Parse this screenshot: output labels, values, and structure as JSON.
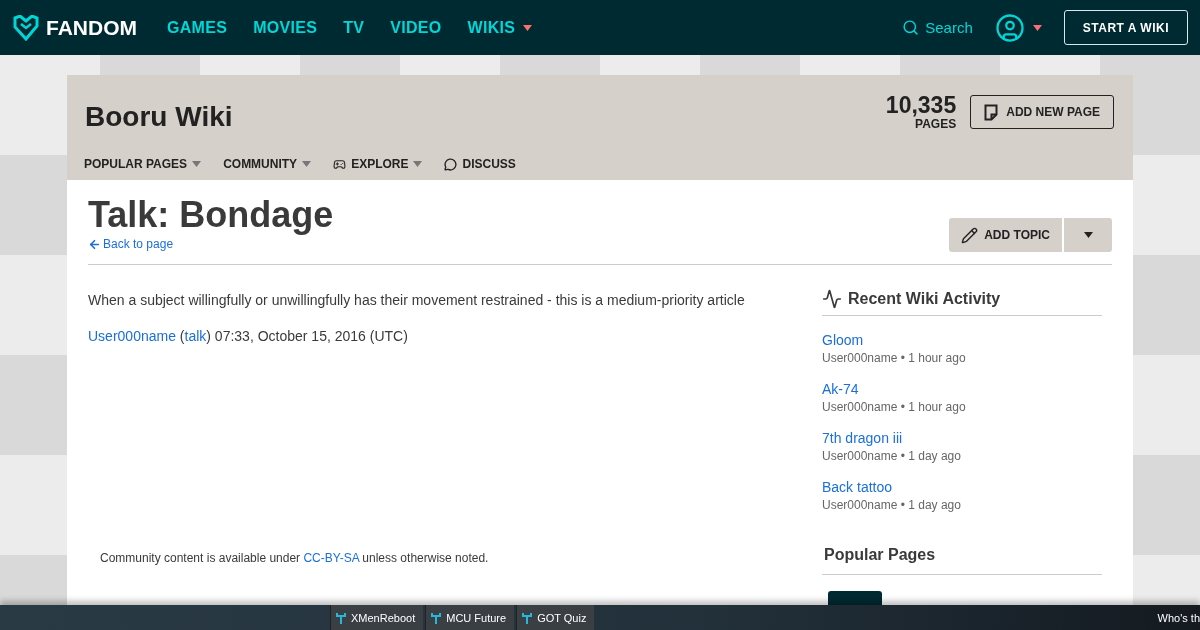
{
  "top_nav": {
    "brand": "FANDOM",
    "links": [
      {
        "label": "GAMES",
        "dropdown": false
      },
      {
        "label": "MOVIES",
        "dropdown": false
      },
      {
        "label": "TV",
        "dropdown": false
      },
      {
        "label": "VIDEO",
        "dropdown": false
      },
      {
        "label": "WIKIS",
        "dropdown": true
      }
    ],
    "search": "Search",
    "start_button": "START A WIKI"
  },
  "wiki_header": {
    "title": "Booru Wiki",
    "page_count": "10,335",
    "page_count_label": "PAGES",
    "add_button": "ADD NEW PAGE",
    "menu": [
      {
        "label": "POPULAR PAGES",
        "kind": "dropdown"
      },
      {
        "label": "COMMUNITY",
        "kind": "dropdown"
      },
      {
        "label": "EXPLORE",
        "kind": "explore"
      },
      {
        "label": "DISCUSS",
        "kind": "discuss"
      }
    ]
  },
  "article": {
    "title": "Talk: Bondage",
    "back_link": "Back to page",
    "add_topic": "ADD TOPIC",
    "body": "When a subject willingfully or unwillingfully has their movement restrained - this is a medium-priority article",
    "signature": {
      "user": "User000name",
      "open": " (",
      "talk": "talk",
      "rest": ") 07:33, October 15, 2016 (UTC)"
    },
    "license": {
      "before": "Community content is available under ",
      "link": "CC-BY-SA",
      "after": " unless otherwise noted."
    }
  },
  "rail": {
    "activity_title": "Recent Wiki Activity",
    "activity": [
      {
        "title": "Gloom",
        "meta": "User000name • 1 hour ago"
      },
      {
        "title": "Ak-74",
        "meta": "User000name • 1 hour ago"
      },
      {
        "title": "7th dragon iii",
        "meta": "User000name • 1 day ago"
      },
      {
        "title": "Back tattoo",
        "meta": "User000name • 1 day ago"
      }
    ],
    "popular_title": "Popular Pages"
  },
  "bottom_bar": {
    "tabs": [
      "XMenReboot",
      "MCU Future",
      "GOT Quiz"
    ],
    "right_text": "Who's th"
  }
}
